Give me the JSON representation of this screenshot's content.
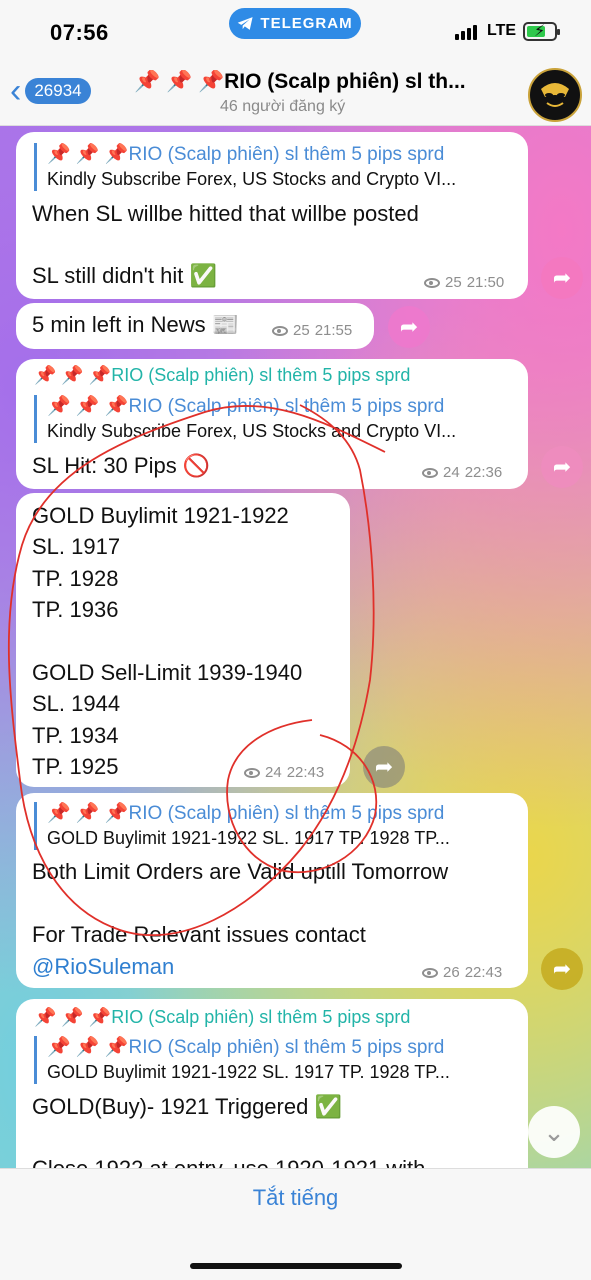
{
  "status_bar": {
    "time": "07:56",
    "app_pill": "TELEGRAM",
    "network": "LTE"
  },
  "header": {
    "back_count": "26934",
    "title": "📌 📌 📌RIO (Scalp phiên) sl th...",
    "subtitle": "46 người đăng ký"
  },
  "messages": {
    "m1": {
      "forward_title": "📌 📌 📌RIO (Scalp phiên) sl thêm 5 pips sprd",
      "forward_text": "Kindly Subscribe Forex, US Stocks and Crypto VI...",
      "line1": "When SL willbe hitted that willbe posted",
      "line2": "SL still didn't hit ✅",
      "views": "25",
      "time": "21:50"
    },
    "m2": {
      "text": "5 min left in News 📰",
      "views": "25",
      "time": "21:55"
    },
    "m3": {
      "sender": "📌 📌 📌RIO (Scalp phiên) sl thêm 5 pips sprd",
      "reply_title": "📌 📌 📌RIO (Scalp phiên) sl thêm 5 pips sprd",
      "reply_text": "Kindly Subscribe Forex, US Stocks and Crypto VI...",
      "text": "SL Hit: 30 Pips 🚫",
      "views": "24",
      "time": "22:36"
    },
    "m4": {
      "lines": [
        "GOLD Buylimit 1921-1922",
        "SL.  1917",
        "TP.   1928",
        "TP.   1936",
        "",
        "GOLD Sell-Limit 1939-1940",
        "SL.   1944",
        "TP.   1934",
        "TP.   1925"
      ],
      "views": "24",
      "time": "22:43"
    },
    "m5": {
      "reply_title": "📌 📌 📌RIO (Scalp phiên) sl thêm 5 pips sprd",
      "reply_text": "GOLD Buylimit 1921-1922 SL.  1917 TP.   1928 TP...",
      "line1": "Both Limit Orders are Valid uptill Tomorrow",
      "line2": "For Trade Relevant issues contact",
      "mention": "@RioSuleman",
      "views": "26",
      "time": "22:43"
    },
    "m6": {
      "sender": "📌 📌 📌RIO (Scalp phiên) sl thêm 5 pips sprd",
      "reply_title": "📌 📌 📌RIO (Scalp phiên) sl thêm 5 pips sprd",
      "reply_text": "GOLD Buylimit 1921-1922 SL.  1917 TP.   1928 TP...",
      "line1": "GOLD(Buy)- 1921 Triggered ✅",
      "line2": "Close 1922 at entry, use 1920-1921 with"
    }
  },
  "bottom": {
    "mute_label": "Tắt tiếng"
  },
  "colors": {
    "accent": "#3a83d6",
    "annotation": "#e0302a"
  }
}
